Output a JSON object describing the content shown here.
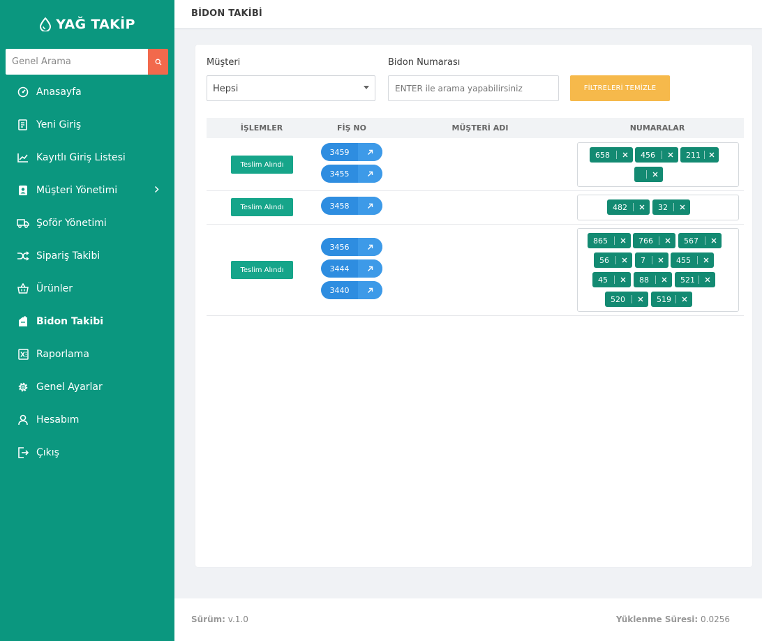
{
  "sidebar": {
    "brand": "YAĞ TAKİP",
    "search_placeholder": "Genel Arama",
    "items": [
      {
        "label": "Anasayfa",
        "icon": "gauge-icon"
      },
      {
        "label": "Yeni Giriş",
        "icon": "document-icon"
      },
      {
        "label": "Kayıtlı Giriş Listesi",
        "icon": "chart-line-icon"
      },
      {
        "label": "Müşteri Yönetimi",
        "icon": "contact-card-icon"
      },
      {
        "label": "Şoför Yönetimi",
        "icon": "truck-icon"
      },
      {
        "label": "Sipariş Takibi",
        "icon": "shuffle-icon"
      },
      {
        "label": "Ürünler",
        "icon": "basket-icon"
      },
      {
        "label": "Bidon Takibi",
        "icon": "canister-icon"
      },
      {
        "label": "Raporlama",
        "icon": "excel-icon"
      },
      {
        "label": "Genel Ayarlar",
        "icon": "gear-icon"
      },
      {
        "label": "Hesabım",
        "icon": "user-icon"
      },
      {
        "label": "Çıkış",
        "icon": "logout-icon"
      }
    ]
  },
  "header": {
    "title": "BİDON TAKİBİ"
  },
  "filters": {
    "musteri_label": "Müşteri",
    "musteri_value": "Hepsi",
    "bidon_label": "Bidon Numarası",
    "bidon_placeholder": "ENTER ile arama yapabilirsiniz",
    "clear_label": "FİLTRELERİ TEMİZLE"
  },
  "table": {
    "headers": [
      "İŞLEMLER",
      "FİŞ NO",
      "MÜŞTERİ ADI",
      "NUMARALAR"
    ],
    "rows": [
      {
        "action": "Teslim Alındı",
        "fis": [
          "3459",
          "3455"
        ],
        "musteri": "",
        "numaralar": [
          "658",
          "456",
          "211",
          ""
        ]
      },
      {
        "action": "Teslim Alındı",
        "fis": [
          "3458"
        ],
        "musteri": "",
        "numaralar": [
          "482",
          "32"
        ]
      },
      {
        "action": "Teslim Alındı",
        "fis": [
          "3456",
          "3444",
          "3440"
        ],
        "musteri": "",
        "numaralar": [
          "865",
          "766",
          "567",
          "56",
          "7",
          "455",
          "45",
          "88",
          "521",
          "520",
          "519"
        ]
      }
    ]
  },
  "footer": {
    "version_label": "Sürüm:",
    "version_value": "v.1.0",
    "load_label": "Yüklenme Süresi:",
    "load_value": "0.0256"
  },
  "colors": {
    "sidebar": "#0b977f",
    "search_button": "#f2694c",
    "clear_button": "#f6b94b",
    "teslim_button": "#16a58a",
    "fis_pill": "#2e8de0",
    "tag": "#138a72"
  }
}
